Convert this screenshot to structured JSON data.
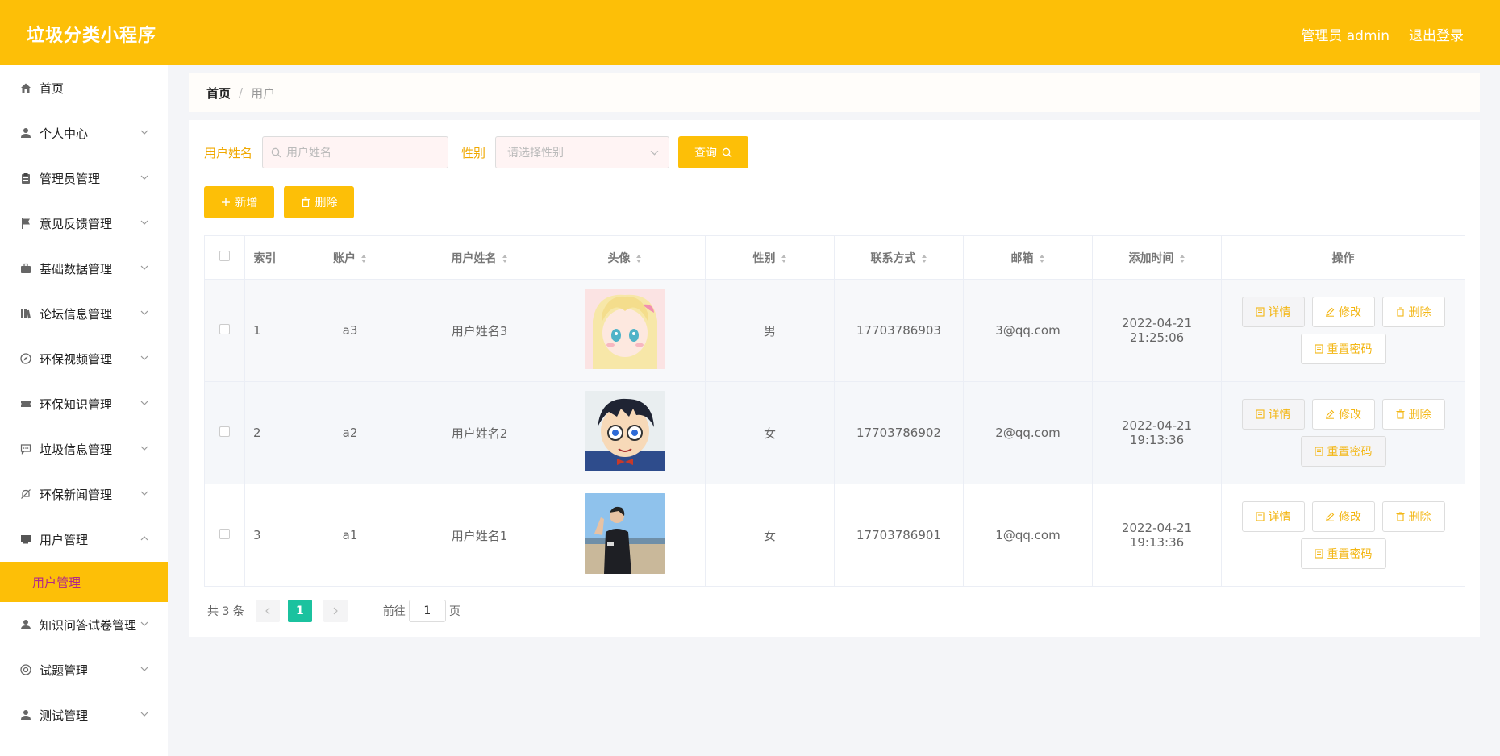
{
  "header": {
    "title": "垃圾分类小程序",
    "admin_label": "管理员 admin",
    "logout_label": "退出登录"
  },
  "colors": {
    "accent": "#fdbf07",
    "pager_active": "#1bc29f",
    "submenu_text": "#b0278a"
  },
  "sidebar": {
    "items": [
      {
        "label": "首页",
        "icon": "home-icon"
      },
      {
        "label": "个人中心",
        "icon": "user-icon"
      },
      {
        "label": "管理员管理",
        "icon": "clipboard-icon"
      },
      {
        "label": "意见反馈管理",
        "icon": "flag-icon"
      },
      {
        "label": "基础数据管理",
        "icon": "briefcase-icon"
      },
      {
        "label": "论坛信息管理",
        "icon": "books-icon"
      },
      {
        "label": "环保视频管理",
        "icon": "compass-icon"
      },
      {
        "label": "环保知识管理",
        "icon": "ticket-icon"
      },
      {
        "label": "垃圾信息管理",
        "icon": "chat-icon"
      },
      {
        "label": "环保新闻管理",
        "icon": "bell-off-icon"
      },
      {
        "label": "用户管理",
        "icon": "monitor-icon"
      },
      {
        "label": "知识问答试卷管理",
        "icon": "user-icon"
      },
      {
        "label": "试题管理",
        "icon": "lifebuoy-icon"
      },
      {
        "label": "测试管理",
        "icon": "user-icon"
      }
    ],
    "active_sub": "用户管理"
  },
  "breadcrumb": {
    "home": "首页",
    "separator": "/",
    "current": "用户"
  },
  "search": {
    "name_label": "用户姓名",
    "name_placeholder": "用户姓名",
    "gender_label": "性别",
    "gender_placeholder": "请选择性别",
    "query_button": "查询"
  },
  "actions": {
    "add": "新增",
    "delete": "删除"
  },
  "table": {
    "headers": [
      "索引",
      "账户",
      "用户姓名",
      "头像",
      "性别",
      "联系方式",
      "邮箱",
      "添加时间",
      "操作"
    ],
    "rows": [
      {
        "index": "1",
        "account": "a3",
        "name": "用户姓名3",
        "gender": "男",
        "phone": "17703786903",
        "email": "3@qq.com",
        "created": "2022-04-21 21:25:06"
      },
      {
        "index": "2",
        "account": "a2",
        "name": "用户姓名2",
        "gender": "女",
        "phone": "17703786902",
        "email": "2@qq.com",
        "created": "2022-04-21 19:13:36"
      },
      {
        "index": "3",
        "account": "a1",
        "name": "用户姓名1",
        "gender": "女",
        "phone": "17703786901",
        "email": "1@qq.com",
        "created": "2022-04-21 19:13:36"
      }
    ],
    "row_actions": {
      "detail": "详情",
      "edit": "修改",
      "delete": "删除",
      "reset_password": "重置密码"
    }
  },
  "pagination": {
    "total_text": "共 3 条",
    "current_page": "1",
    "goto_prefix": "前往",
    "goto_value": "1",
    "goto_suffix": "页"
  }
}
